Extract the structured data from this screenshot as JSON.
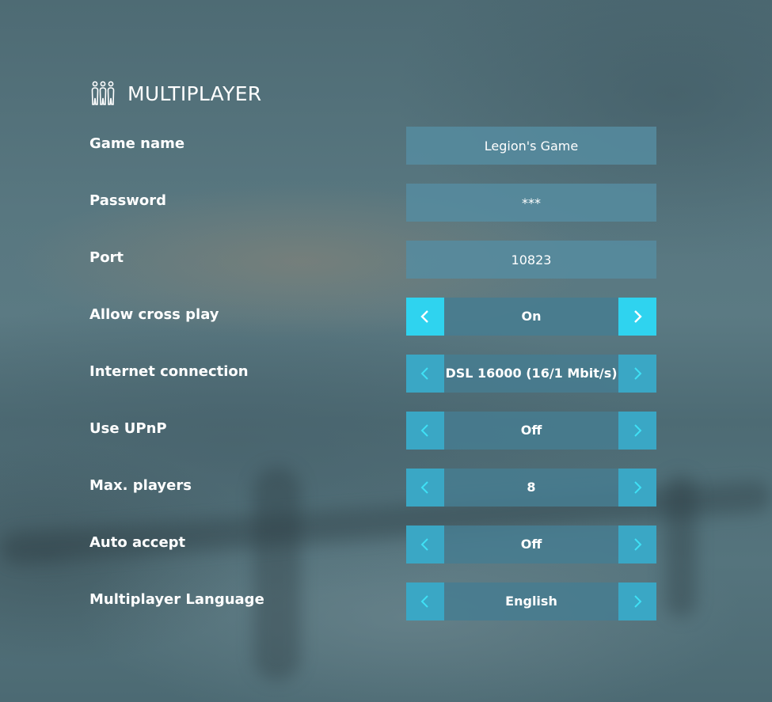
{
  "header": {
    "title": "MULTIPLAYER",
    "icon": "players-group-icon"
  },
  "fields": [
    {
      "label": "Game name",
      "value": "Legion's Game"
    },
    {
      "label": "Password",
      "value": "***"
    },
    {
      "label": "Port",
      "value": "10823"
    }
  ],
  "selectors": [
    {
      "label": "Allow cross play",
      "value": "On",
      "focused": true
    },
    {
      "label": "Internet connection",
      "value": "DSL 16000 (16/1 Mbit/s)",
      "focused": false
    },
    {
      "label": "Use UPnP",
      "value": "Off",
      "focused": false
    },
    {
      "label": "Max. players",
      "value": "8",
      "focused": false
    },
    {
      "label": "Auto accept",
      "value": "Off",
      "focused": false
    },
    {
      "label": "Multiplayer Language",
      "value": "English",
      "focused": false
    }
  ],
  "colors": {
    "arrow_default": "#3aa7c5",
    "arrow_focused": "#2fd3ef",
    "field_bg": "#568ca0",
    "text": "#ffffff"
  },
  "icons": {
    "left_arrow": "chevron-left-icon",
    "right_arrow": "chevron-right-icon"
  }
}
